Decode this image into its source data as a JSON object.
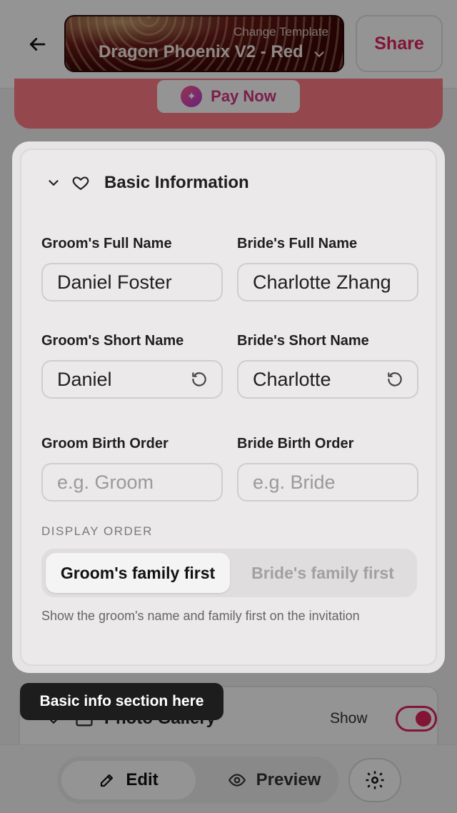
{
  "topbar": {
    "template_caption": "Change Template",
    "template_name": "Dragon Phoenix V2 - Red",
    "share_label": "Share"
  },
  "banner": {
    "pay_label": "Pay Now"
  },
  "basic_info": {
    "title": "Basic Information",
    "groom_full_label": "Groom's Full Name",
    "groom_full_value": "Daniel Foster",
    "bride_full_label": "Bride's Full Name",
    "bride_full_value": "Charlotte Zhang",
    "groom_short_label": "Groom's Short Name",
    "groom_short_value": "Daniel",
    "bride_short_label": "Bride's Short Name",
    "bride_short_value": "Charlotte",
    "groom_order_label": "Groom Birth Order",
    "groom_order_placeholder": "e.g. Groom",
    "bride_order_label": "Bride Birth Order",
    "bride_order_placeholder": "e.g. Bride",
    "display_order_label": "DISPLAY ORDER",
    "order_options": [
      "Groom's family first",
      "Bride's family first"
    ],
    "order_selected": "Groom's family first",
    "hint": "Show the groom's name and family first on the invitation"
  },
  "tooltip": "Basic info section here",
  "photo_gallery": {
    "title": "Photo Gallery",
    "show_label": "Show",
    "enabled": true
  },
  "bottom_nav": {
    "edit_label": "Edit",
    "preview_label": "Preview"
  },
  "colors": {
    "accent": "#e0245e",
    "banner": "#ff7b85"
  },
  "icons": [
    "back-arrow-icon",
    "chevron-down-icon",
    "sparkle-icon",
    "heart-icon",
    "reset-icon",
    "image-icon",
    "edit-icon",
    "eye-icon",
    "gear-icon"
  ]
}
